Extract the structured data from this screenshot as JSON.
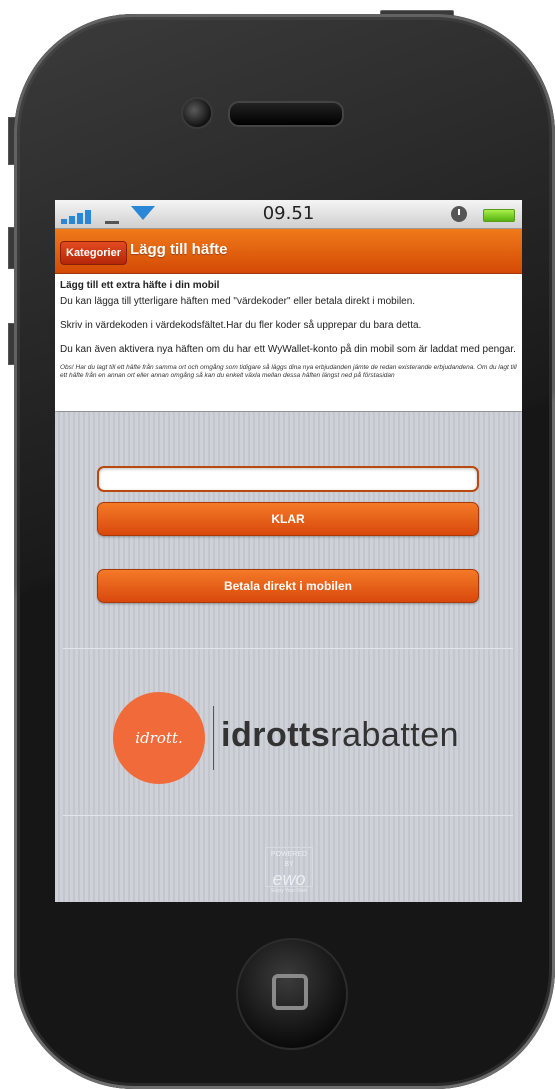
{
  "status_bar": {
    "time": "09.51"
  },
  "header": {
    "back_label": "Kategorier",
    "title": "Lägg till häfte"
  },
  "info": {
    "heading": "Lägg till ett extra häfte i din mobil",
    "p1": "Du kan lägga till ytterligare häften med \"värdekoder\" eller betala direkt i mobilen.",
    "p2": "Skriv in värdekoden i värdekodsfältet.Har du fler koder så upprepar du bara detta.",
    "p3": "Du kan även aktivera nya häften om du har ett WyWallet-konto på din mobil som är laddat med pengar.",
    "note": "Obs! Har du lagt till ett häfte från samma ort och omgång som tidigare så läggs dina nya erbjudanden jämte de redan existerande erbjudandena. Om du lagt till ett häfte från en annan ort eller annan omgång så kan du enkelt växla mellan dessa häften längst ned på förstasidan"
  },
  "form": {
    "code_value": "",
    "klar_label": "KLAR",
    "betala_label": "Betala direkt i mobilen"
  },
  "logo": {
    "circle_text": "idrott.",
    "brand_bold": "idrotts",
    "brand_light": "rabatten"
  },
  "footer": {
    "powered_by": "POWERED BY",
    "powered_brand": "ewo",
    "powered_tagline": "Enjoy Your Own"
  }
}
